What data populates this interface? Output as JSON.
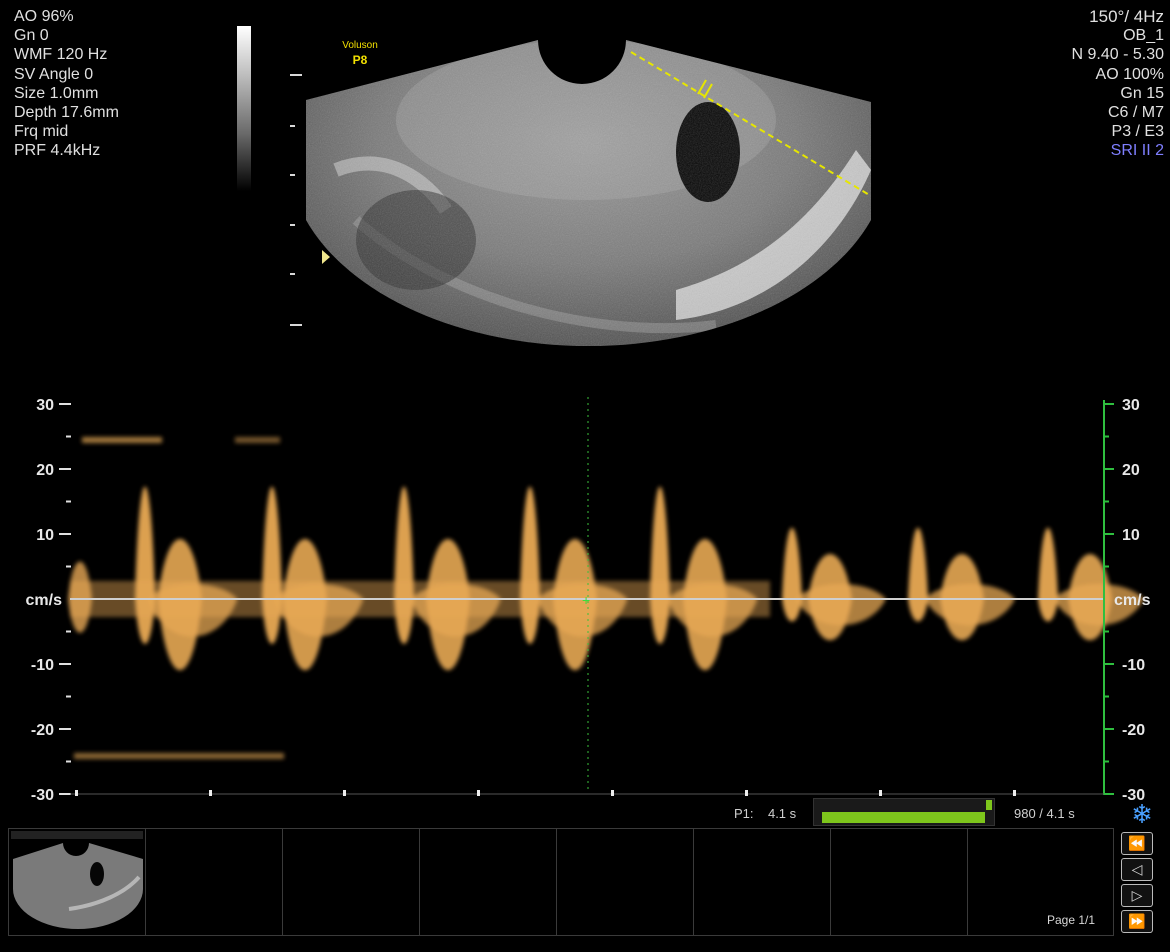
{
  "left_params": [
    "AO 96%",
    "Gn  0",
    "WMF 120 Hz",
    "SV Angle  0",
    "Size  1.0mm",
    "Depth 17.6mm",
    "Frq mid",
    "PRF  4.4kHz"
  ],
  "right_params": [
    "150°/  4Hz",
    "OB_1",
    "N 9.40 - 5.30",
    "AO 100%",
    "Gn  15",
    "C6 / M7",
    "P3 / E3",
    "SRI II 2"
  ],
  "brand": {
    "line1": "Voluson",
    "line2": "P8"
  },
  "colors": {
    "spectrum": "#f4b25a",
    "accent_green": "#7ec61c",
    "scale_green": "#2fbf3f",
    "sri_blue": "#7f7fff",
    "cursor_yellow": "#e6e600"
  },
  "doppler": {
    "unit": "cm/s",
    "left_ticks": [
      "30",
      "20",
      "10",
      "cm/s",
      "-10",
      "-20",
      "-30"
    ],
    "right_ticks": [
      "30",
      "20",
      "10",
      "cm/s",
      "-10",
      "-20",
      "-30"
    ]
  },
  "status": {
    "p1_label": "P1:",
    "p1_value": "4.1 s",
    "frames": "980 / 4.1 s",
    "cine_progress": 0.97
  },
  "thumbnails": {
    "page": "Page 1/1"
  },
  "icons": [
    "freeze-snowflake-icon",
    "rewind-icon",
    "step-back-icon",
    "step-forward-icon",
    "fast-forward-icon"
  ]
}
